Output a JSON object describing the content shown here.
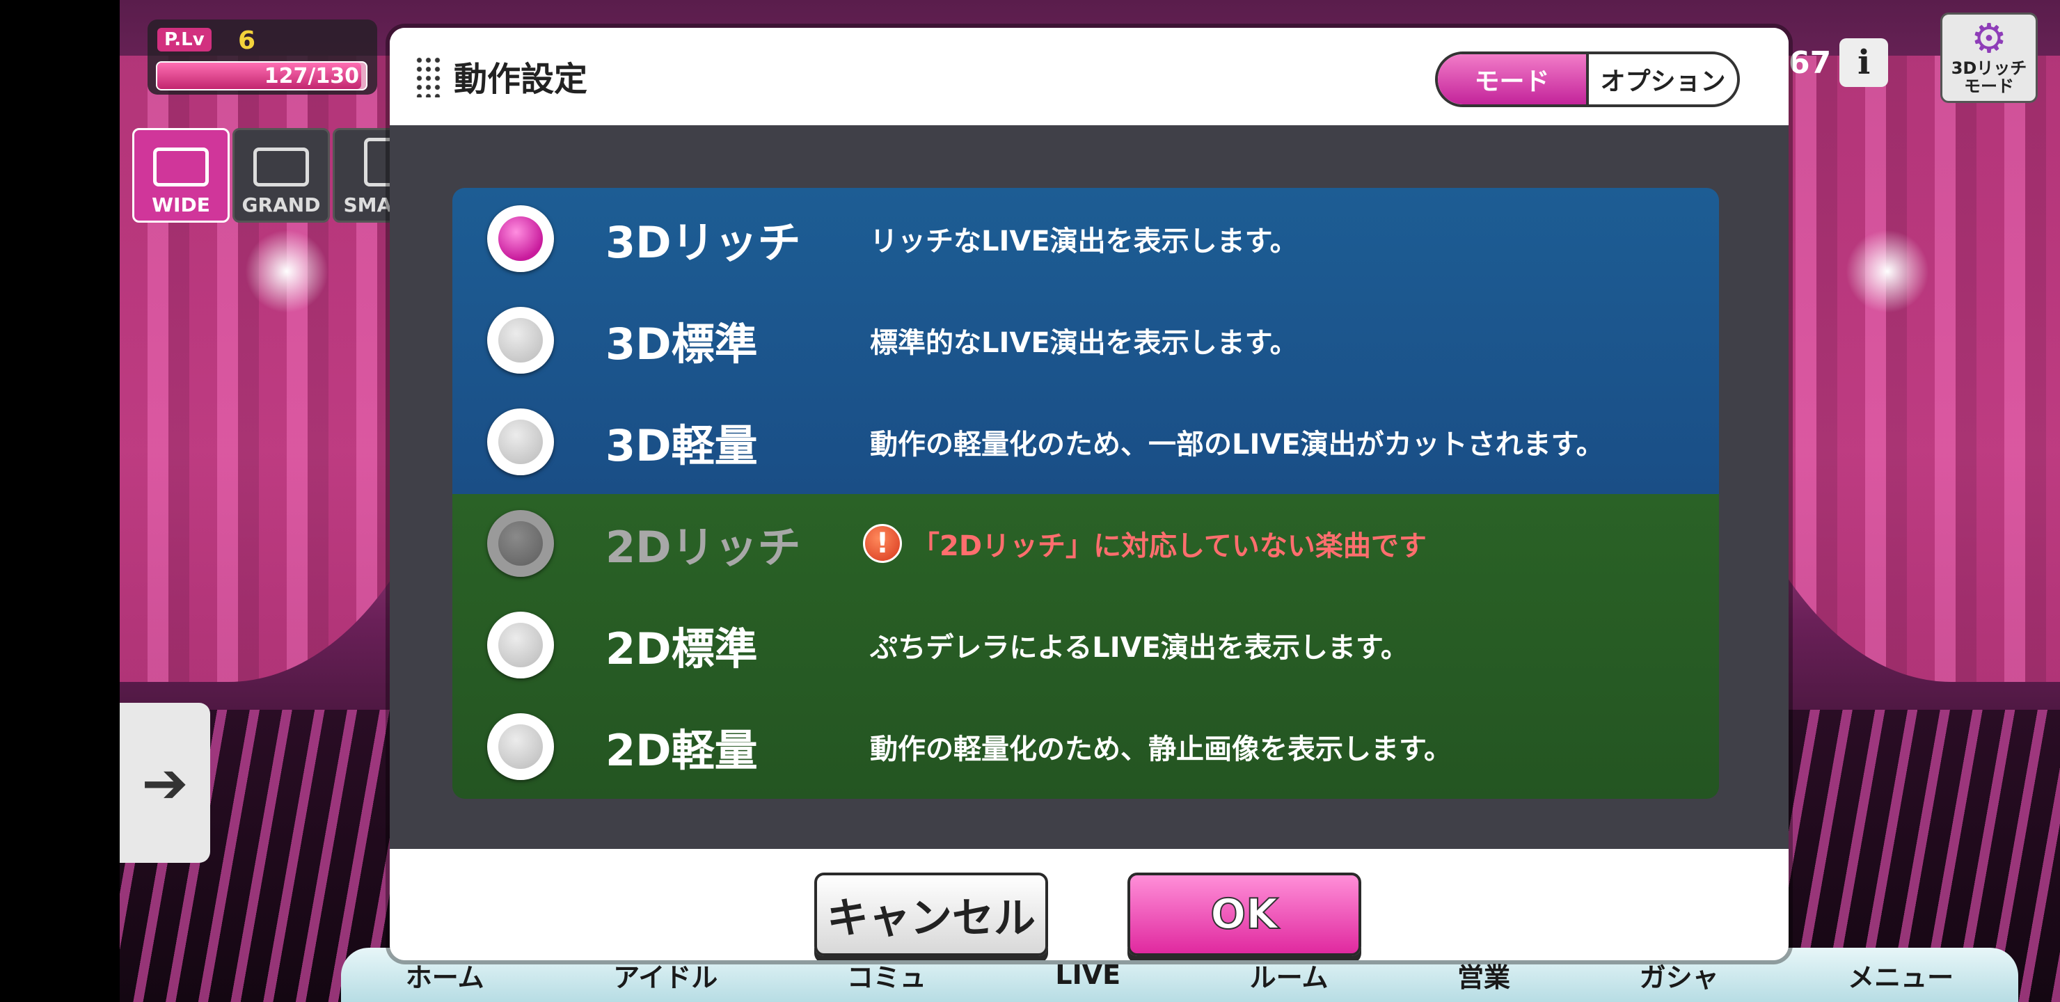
{
  "hud": {
    "plv_tag": "P.Lv",
    "plv_level": "6",
    "plv_exp": "127/130",
    "plv_progress": 0.977,
    "view_buttons": [
      "WIDE",
      "GRAND",
      "SMART"
    ],
    "count": "67",
    "info_glyph": "i",
    "mode_button_label": "3Dリッチ\nモード",
    "mode_button_icon": "gear-icon"
  },
  "dialog": {
    "title": "動作設定",
    "tabs": [
      {
        "label": "モード",
        "active": true
      },
      {
        "label": "オプション",
        "active": false
      }
    ],
    "options": [
      {
        "name": "3Dリッチ",
        "desc": "リッチなLIVE演出を表示します。",
        "checked": true,
        "disabled": false
      },
      {
        "name": "3D標準",
        "desc": "標準的なLIVE演出を表示します。",
        "checked": false,
        "disabled": false
      },
      {
        "name": "3D軽量",
        "desc": "動作の軽量化のため、一部のLIVE演出がカットされます。",
        "checked": false,
        "disabled": false
      },
      {
        "name": "2Dリッチ",
        "desc": "「2Dリッチ」に対応していない楽曲です",
        "checked": false,
        "disabled": true,
        "warning_icon": "!"
      },
      {
        "name": "2D標準",
        "desc": "ぷちデレラによるLIVE演出を表示します。",
        "checked": false,
        "disabled": false
      },
      {
        "name": "2D軽量",
        "desc": "動作の軽量化のため、静止画像を表示します。",
        "checked": false,
        "disabled": false
      }
    ],
    "cancel_label": "キャンセル",
    "ok_label": "OK"
  },
  "bottom_nav": [
    "ホーム",
    "アイドル",
    "コミュ",
    "LIVE",
    "ルーム",
    "営業",
    "ガシャ",
    "メニュー"
  ],
  "colors": {
    "accent": "#e0299f",
    "band_3d": "#1d5d94",
    "band_2d": "#2a6226",
    "warning_text": "#ff6e6e"
  }
}
